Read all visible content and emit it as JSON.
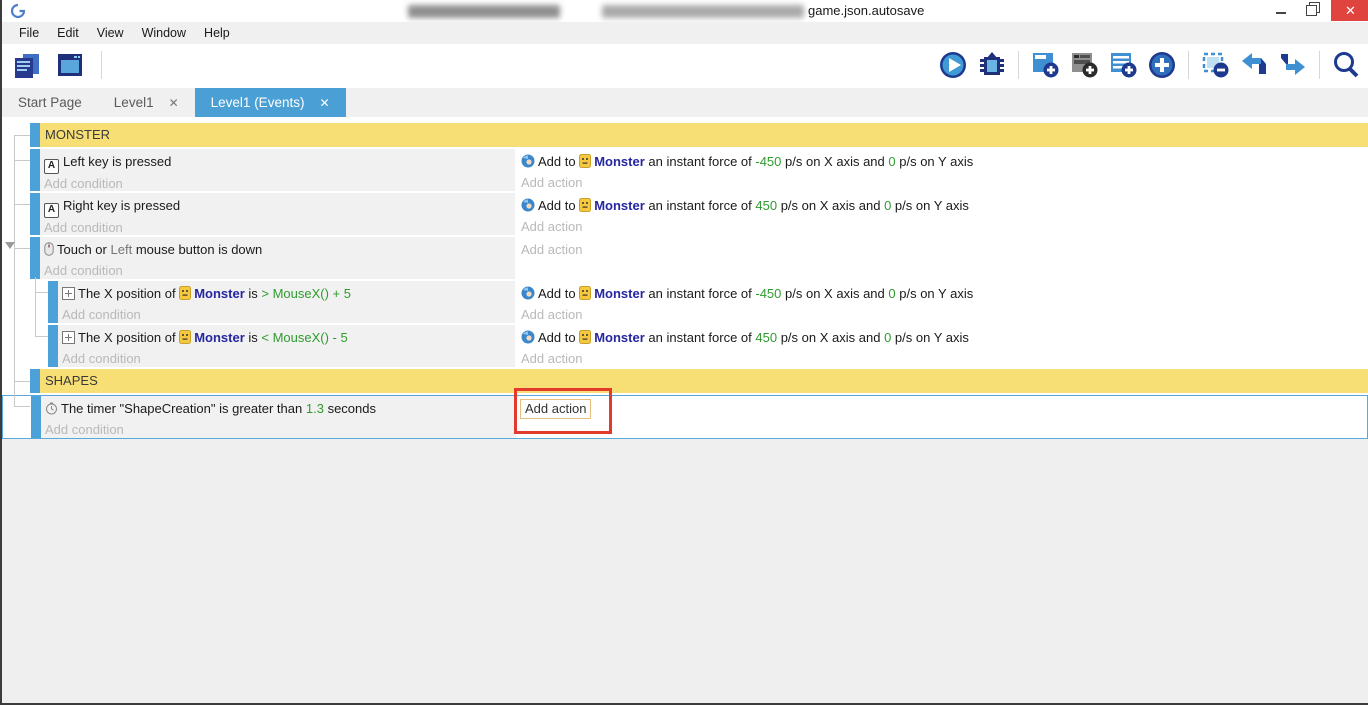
{
  "titlebar": {
    "title": "game.json.autosave",
    "close": "✕"
  },
  "menubar": {
    "items": [
      "File",
      "Edit",
      "View",
      "Window",
      "Help"
    ]
  },
  "toolbar": {
    "left_icons": [
      "project-manager-icon",
      "start-page-icon"
    ],
    "right_icons": [
      "play-icon",
      "debug-icon",
      "add-event-icon",
      "add-subevent-icon",
      "add-comment-icon",
      "add-new-icon",
      "delete-event-icon",
      "undo-icon",
      "redo-icon",
      "search-icon"
    ]
  },
  "tabs": {
    "start": "Start Page",
    "level1": "Level1",
    "events": "Level1 (Events)",
    "close_glyph": "✕"
  },
  "colors": {
    "accent_blue": "#4aa0d5",
    "group_yellow": "#f7df76",
    "value_green": "#2f9b2f",
    "object_blue": "#2626a0",
    "annotation_red": "#e23b2e"
  },
  "icons": {
    "key_a": "A"
  },
  "events": {
    "groups": {
      "monster": "MONSTER",
      "shapes": "SHAPES"
    },
    "ph": {
      "condition": "Add condition",
      "action": "Add action"
    },
    "rows": {
      "e1": {
        "cond": "Left key is pressed"
      },
      "e2": {
        "cond": "Right key is pressed"
      },
      "e3": {
        "pre": "Touch or",
        "param": "Left",
        "post": "mouse button is down"
      },
      "sub1": {
        "pre": "The X position of",
        "obj": "Monster",
        "is": "is",
        "expr": "> MouseX() + 5"
      },
      "sub2": {
        "pre": "The X position of",
        "obj": "Monster",
        "is": "is",
        "expr": "< MouseX() - 5"
      },
      "timer": {
        "pre": "The timer",
        "name": "\"ShapeCreation\"",
        "mid": "is greater than",
        "val": "1.3",
        "post": "seconds"
      }
    },
    "actions": {
      "a1": {
        "pre": "Add to",
        "obj": "Monster",
        "mid": "an instant force of",
        "vx": "-450",
        "xa": "p/s on X axis and",
        "vy": "0",
        "ya": "p/s on Y axis"
      },
      "a2": {
        "pre": "Add to",
        "obj": "Monster",
        "mid": "an instant force of",
        "vx": "450",
        "xa": "p/s on X axis and",
        "vy": "0",
        "ya": "p/s on Y axis"
      },
      "a3": {
        "pre": "Add to",
        "obj": "Monster",
        "mid": "an instant force of",
        "vx": "-450",
        "xa": "p/s on X axis and",
        "vy": "0",
        "ya": "p/s on Y axis"
      },
      "a4": {
        "pre": "Add to",
        "obj": "Monster",
        "mid": "an instant force of",
        "vx": "450",
        "xa": "p/s on X axis and",
        "vy": "0",
        "ya": "p/s on Y axis"
      }
    }
  }
}
